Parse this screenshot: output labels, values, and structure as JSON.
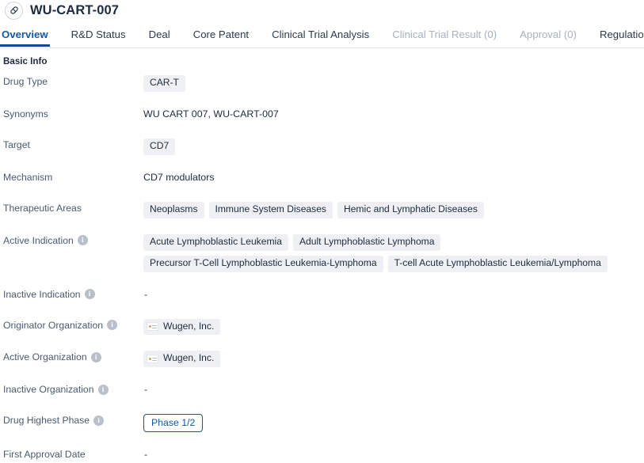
{
  "header": {
    "title": "WU-CART-007",
    "avatar_icon": "capsule-pill-icon"
  },
  "tabs": [
    {
      "label": "Overview",
      "active": true,
      "disabled": false
    },
    {
      "label": "R&D Status",
      "active": false,
      "disabled": false
    },
    {
      "label": "Deal",
      "active": false,
      "disabled": false
    },
    {
      "label": "Core Patent",
      "active": false,
      "disabled": false
    },
    {
      "label": "Clinical Trial Analysis",
      "active": false,
      "disabled": false
    },
    {
      "label": "Clinical Trial Result (0)",
      "active": false,
      "disabled": true
    },
    {
      "label": "Approval (0)",
      "active": false,
      "disabled": true
    },
    {
      "label": "Regulation",
      "active": false,
      "disabled": false
    }
  ],
  "section": {
    "title": "Basic Info"
  },
  "fields": {
    "drug_type": {
      "label": "Drug Type",
      "values": [
        "CAR-T"
      ]
    },
    "synonyms": {
      "label": "Synonyms",
      "text": "WU CART 007,  WU-CART-007"
    },
    "target": {
      "label": "Target",
      "values": [
        "CD7"
      ]
    },
    "mechanism": {
      "label": "Mechanism",
      "text": "CD7 modulators"
    },
    "therapeutic_areas": {
      "label": "Therapeutic Areas",
      "values": [
        "Neoplasms",
        "Immune System Diseases",
        "Hemic and Lymphatic Diseases"
      ]
    },
    "active_indication": {
      "label": "Active Indication",
      "has_info": true,
      "values": [
        "Acute Lymphoblastic Leukemia",
        "Adult Lymphoblastic Lymphoma",
        "Precursor T-Cell Lymphoblastic Leukemia-Lymphoma",
        "T-cell Acute Lymphoblastic Leukemia/Lymphoma"
      ]
    },
    "inactive_indication": {
      "label": "Inactive Indication",
      "has_info": true,
      "text": "-"
    },
    "originator_organization": {
      "label": "Originator Organization",
      "has_info": true,
      "values": [
        "Wugen, Inc."
      ]
    },
    "active_organization": {
      "label": "Active Organization",
      "has_info": true,
      "values": [
        "Wugen, Inc."
      ]
    },
    "inactive_organization": {
      "label": "Inactive Organization",
      "has_info": true,
      "text": "-"
    },
    "drug_highest_phase": {
      "label": "Drug Highest Phase",
      "has_info": true,
      "value": "Phase 1/2"
    },
    "first_approval_date": {
      "label": "First Approval Date",
      "has_info": false,
      "text": "-"
    }
  },
  "icons": {
    "info": "i"
  },
  "colors": {
    "accent": "#10499b",
    "active_tab_text": "#1458a6",
    "chip_bg": "#eef0f3",
    "label_text": "#4a5a70",
    "disabled_tab": "#a8b2bf"
  }
}
